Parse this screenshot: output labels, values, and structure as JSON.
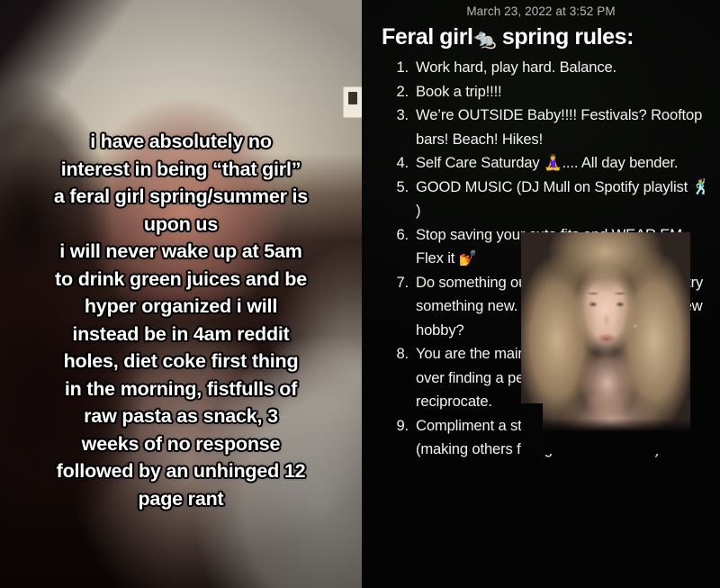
{
  "left_panel": {
    "name": "tiktok-video-frame-left",
    "caption_lines": [
      "i have absolutely no",
      "interest in being “that girl”",
      "a feral girl spring/summer is",
      "upon us",
      "i will never wake up at 5am",
      "to drink green juices and be",
      "hyper organized i will",
      "instead be in 4am reddit",
      "holes, diet coke first thing",
      "in the morning, fistfulls of",
      "raw pasta as snack, 3",
      "weeks of no response",
      "followed by an unhinged 12",
      "page rant"
    ],
    "scene_description": "woman with dark hair in cream-walled room wearing white knit sweater",
    "caption_text_color": "#ffffff",
    "caption_outline_color": "#000000"
  },
  "right_panel": {
    "name": "notes-app-screenshot",
    "background_color": "#040404",
    "text_color": "#f2f2ef",
    "date_color": "#b9b9b4",
    "date": "March 23, 2022 at 3:52 PM",
    "title_prefix": "Feral girl",
    "title_emoji": "🐀",
    "title_suffix": "spring rules:",
    "list": [
      {
        "num": "1.",
        "text": "Work hard, play hard. Balance."
      },
      {
        "num": "2.",
        "text": "Book a trip!!!!"
      },
      {
        "num": "3.",
        "text": "We’re OUTSIDE Baby!!!! Festivals? Rooftop bars! Beach! Hikes!"
      },
      {
        "num": "4.",
        "text": "Self Care Saturday 🧘‍♀️.... All day bender."
      },
      {
        "num": "5.",
        "text": "GOOD MUSIC (DJ Mull on Spotify playlist 🕺 )"
      },
      {
        "num": "6.",
        "text": "Stop saving your cute fits and WEAR EM. Flex it 💅"
      },
      {
        "num": "7.",
        "text": "Do something outside your comfort zone/ try something new. Club? New art exhibit? New hobby?"
      },
      {
        "num": "8.",
        "text": "You are the main character. Don’t obsess over finding a person who doesn’t reciprocate."
      },
      {
        "num": "9.",
        "text": "Compliment a stranger, give back out (making others feel good is soul food)"
      }
    ],
    "video_inset": {
      "name": "inset-talking-head-video",
      "description": "blonde woman talking to camera over black background"
    }
  }
}
